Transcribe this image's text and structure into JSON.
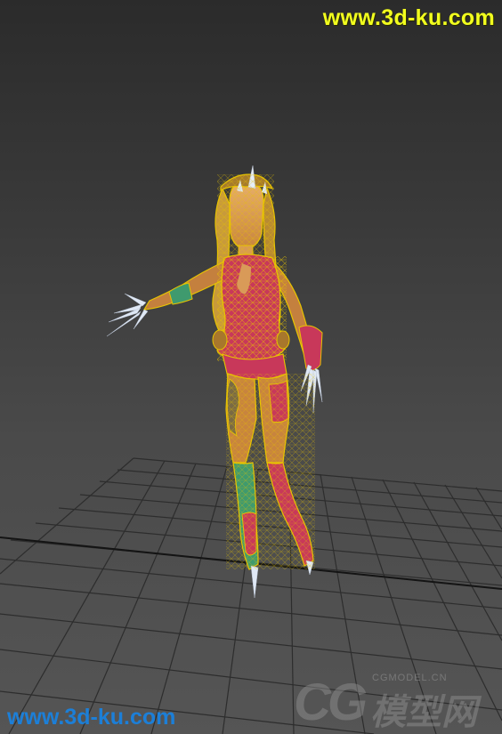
{
  "watermarks": {
    "top": "www.3d-ku.com",
    "bottom": "www.3d-ku.com"
  },
  "logo": {
    "mark": "CG",
    "name": "CGMODEL.CN",
    "chinese": "模型网"
  },
  "colors": {
    "top_watermark": "#f2ff1e",
    "bottom_watermark": "#1c7fd8",
    "wireframe": "#e8c400",
    "outfit": "#c8385a",
    "skin": "#e2a25a",
    "boot_green": "#3f9a6e",
    "grid": "#2a2a2a",
    "claw": "#dfe8f5"
  }
}
